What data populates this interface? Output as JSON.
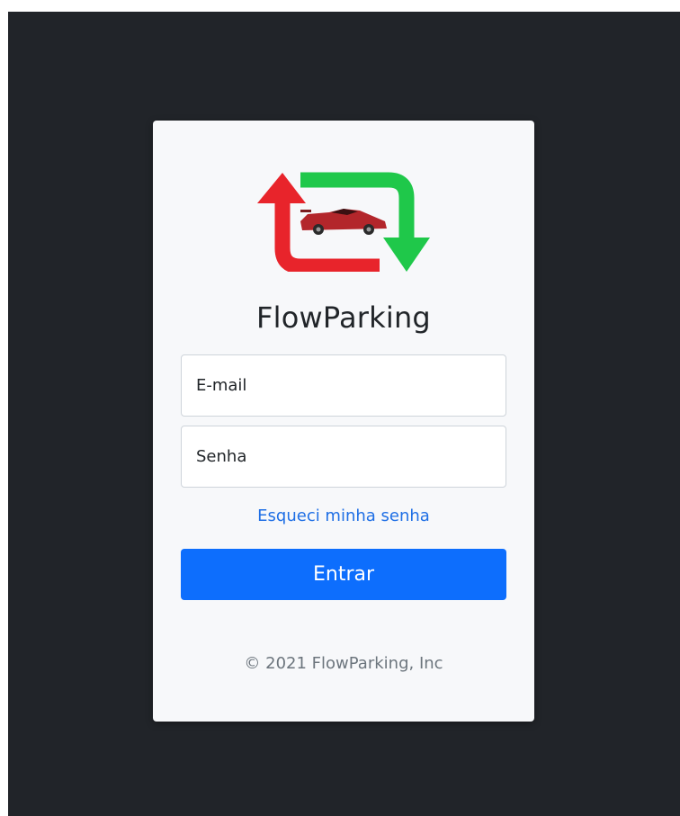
{
  "brand": {
    "name": "FlowParking",
    "logo_icon": "car-arrows-logo-icon",
    "colors": {
      "arrow_red": "#e8242b",
      "arrow_green": "#1fc84a",
      "car": "#b3262b"
    }
  },
  "login": {
    "email_placeholder": "E-mail",
    "password_placeholder": "Senha",
    "forgot_link": "Esqueci minha senha",
    "submit_label": "Entrar"
  },
  "footer": {
    "copyright": "© 2021 FlowParking, Inc"
  },
  "colors": {
    "backdrop": "#212429",
    "card": "#f7f8fa",
    "primary": "#0d6efd",
    "link": "#1f6fe5"
  }
}
